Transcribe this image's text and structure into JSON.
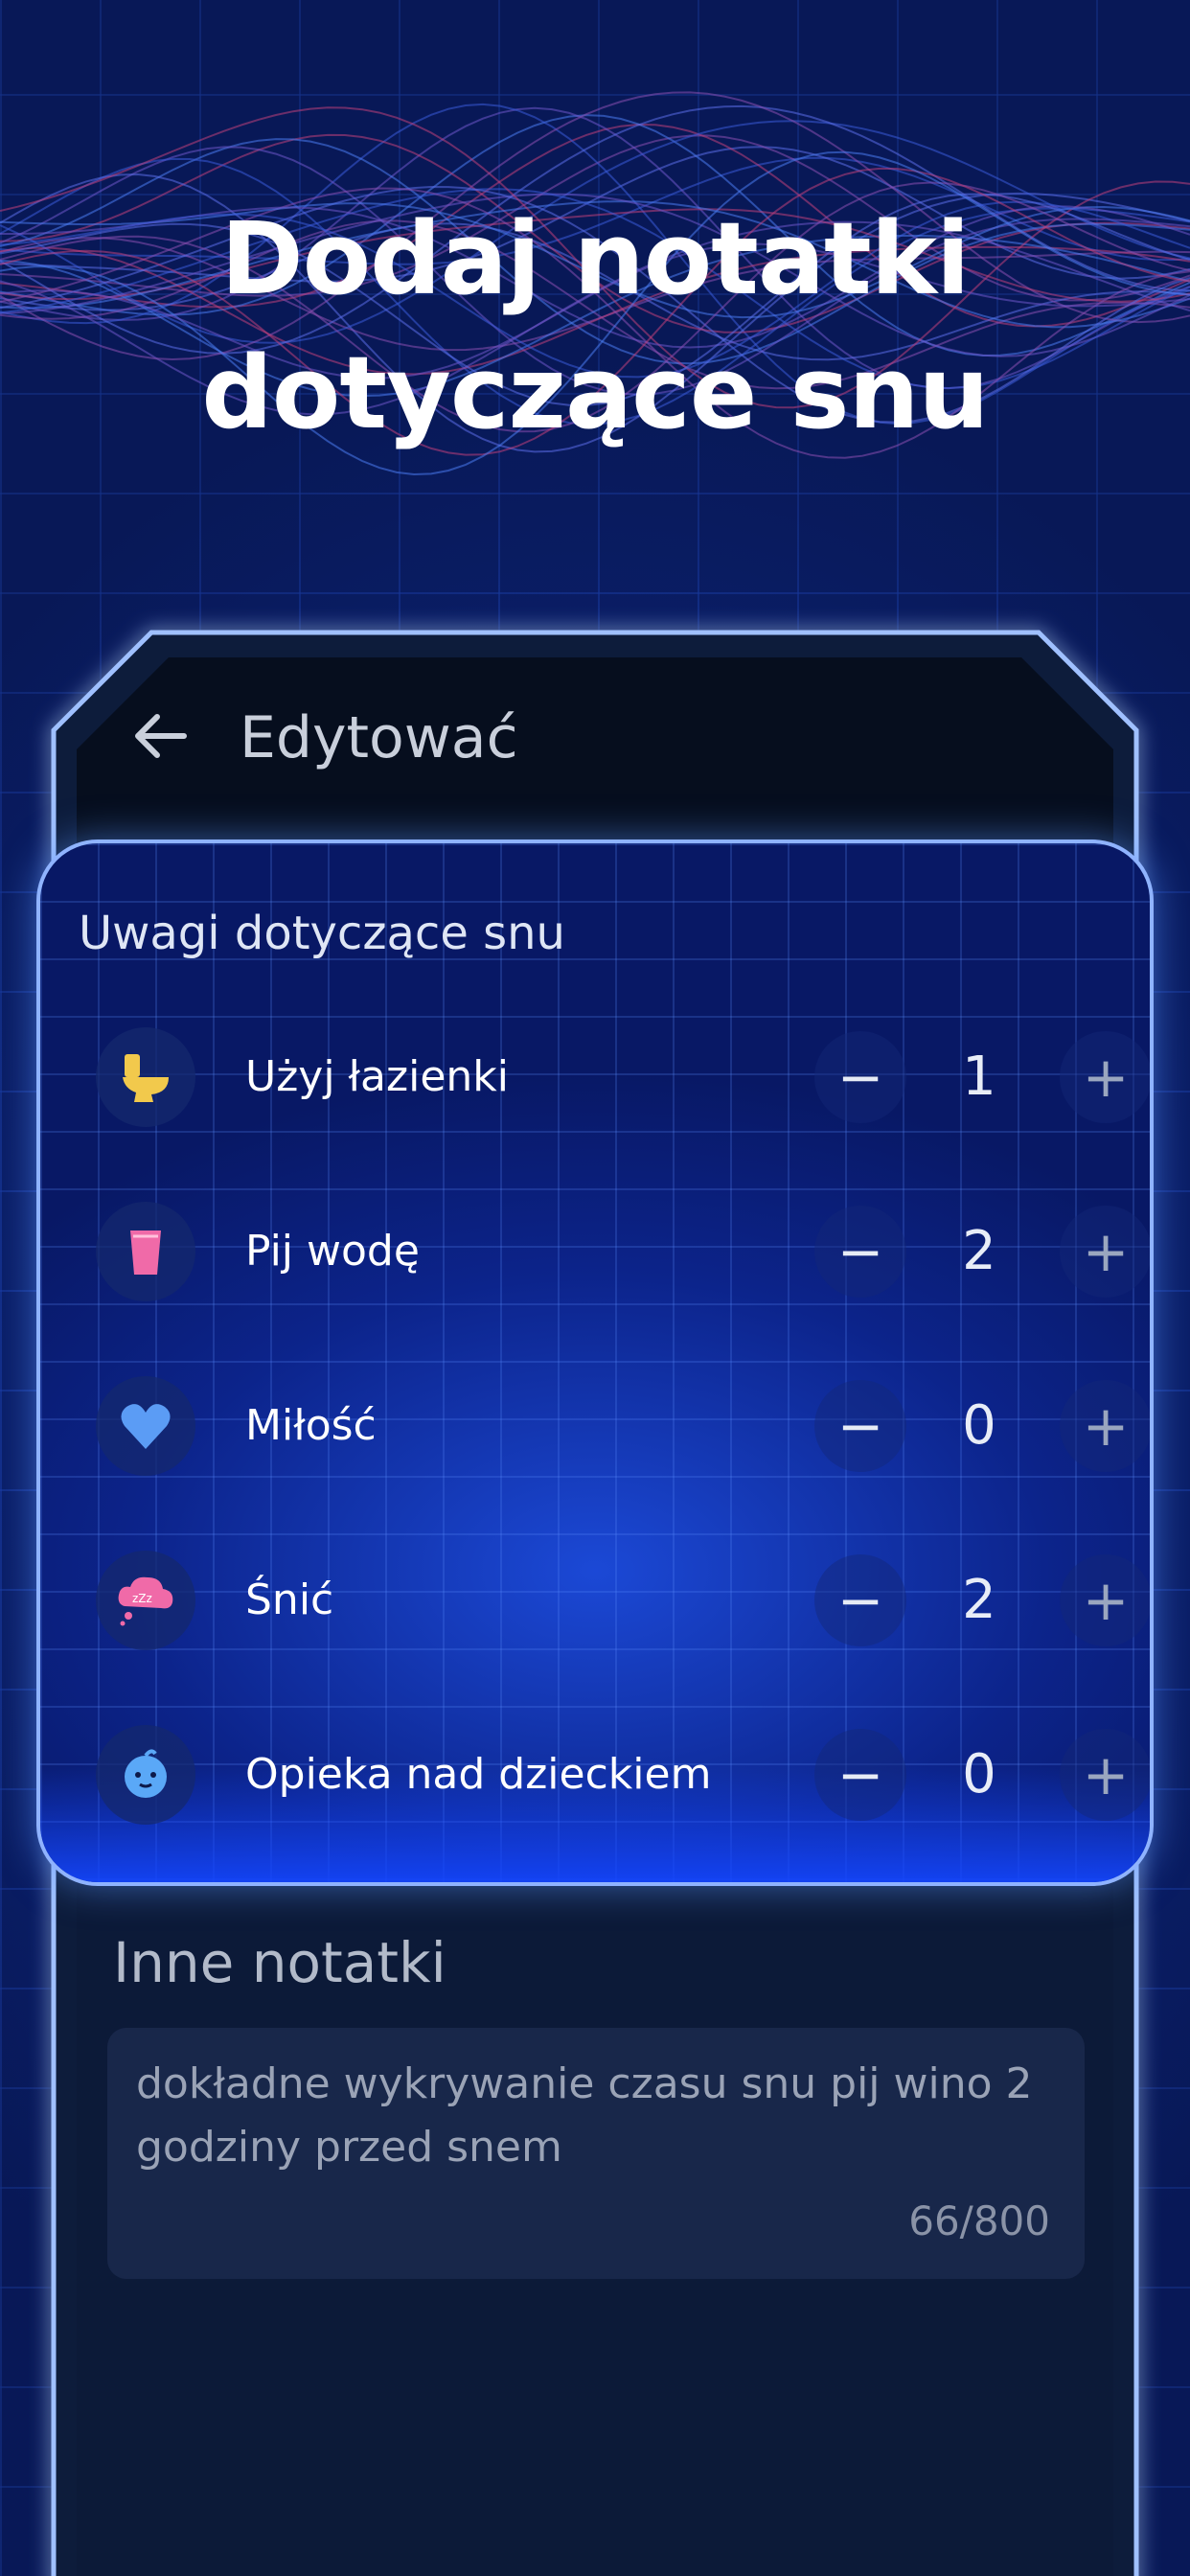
{
  "headline": {
    "line1": "Dodaj notatki",
    "line2": "dotyczące snu"
  },
  "topbar": {
    "title": "Edytować",
    "back_icon": "arrow-left-icon"
  },
  "notes_panel": {
    "title": "Uwagi dotyczące snu",
    "minus_glyph": "−",
    "plus_glyph": "+",
    "items": [
      {
        "label": "Użyj łazienki",
        "count": "1",
        "icon": "toilet-icon",
        "icon_color": "#f2c94c"
      },
      {
        "label": "Pij wodę",
        "count": "2",
        "icon": "water-glass-icon",
        "icon_color": "#f06aa8"
      },
      {
        "label": "Miłość",
        "count": "0",
        "icon": "heart-icon",
        "icon_color": "#5b9cf5"
      },
      {
        "label": "Śnić",
        "count": "2",
        "icon": "dream-icon",
        "icon_color": "#f06aa8"
      },
      {
        "label": "Opieka nad dzieckiem",
        "count": "0",
        "icon": "baby-icon",
        "icon_color": "#5aa8f7"
      }
    ]
  },
  "other_notes": {
    "title": "Inne notatki",
    "text": "dokładne wykrywanie czasu snu pij wino 2 godziny przed snem",
    "char_count": "66/800"
  },
  "colors": {
    "background": "#0c2478",
    "panel_border": "#8fb3ff",
    "device_frame": "#0d1a3a",
    "text_primary": "#ffffff"
  }
}
